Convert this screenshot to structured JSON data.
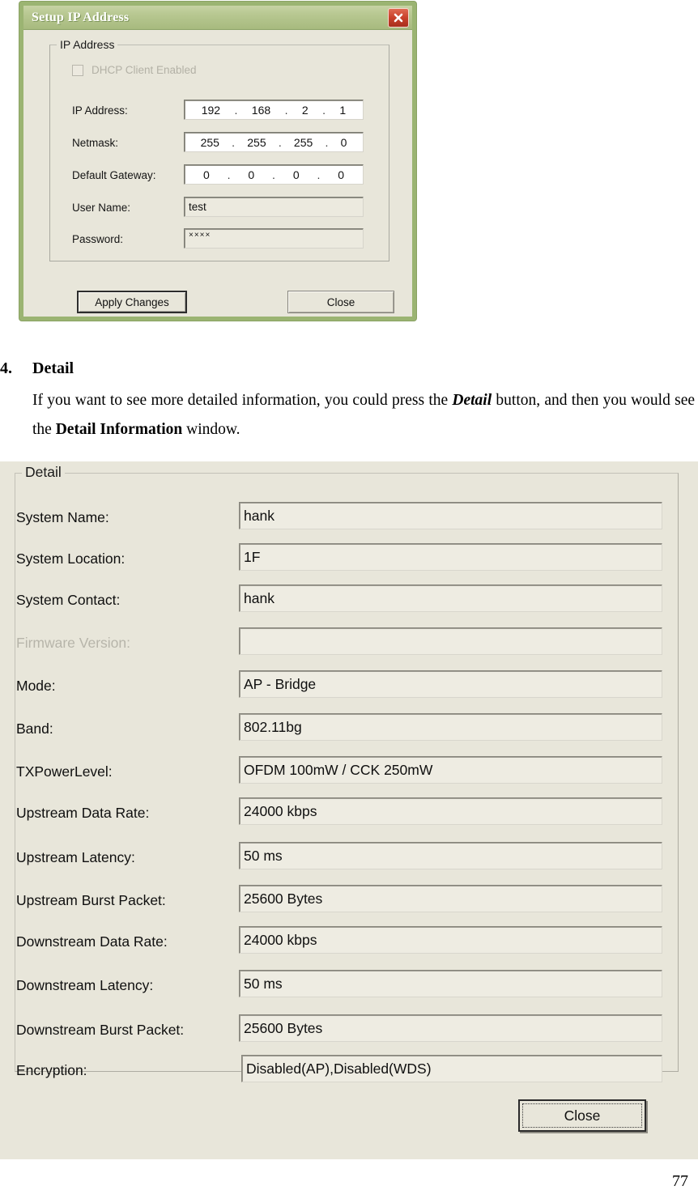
{
  "ip_dialog": {
    "title": "Setup IP Address",
    "close_icon": "close-x-icon",
    "groupbox_legend": "IP Address",
    "dhcp_checkbox_label": "DHCP Client Enabled",
    "dhcp_checked": false,
    "dhcp_enabled": false,
    "fields": [
      {
        "label": "IP Address:",
        "type": "octets",
        "octets": [
          "192",
          "168",
          "2",
          "1"
        ]
      },
      {
        "label": "Netmask:",
        "type": "octets",
        "octets": [
          "255",
          "255",
          "255",
          "0"
        ]
      },
      {
        "label": "Default Gateway:",
        "type": "octets",
        "octets": [
          "0",
          "0",
          "0",
          "0"
        ]
      },
      {
        "label": "User Name:",
        "type": "text",
        "value": "test"
      },
      {
        "label": "Password:",
        "type": "password",
        "value": "××××"
      }
    ],
    "apply_button": "Apply Changes",
    "apply_mnemonic": "A",
    "close_button": "Close",
    "close_mnemonic": "C"
  },
  "body_text": {
    "number": "4.",
    "heading": "Detail",
    "paragraph_1a": "If you want to see more detailed information, you could press the ",
    "paragraph_1b": "Detail",
    "paragraph_1c": " button,",
    "paragraph_2a": "and then you would see the ",
    "paragraph_2b": "Detail Information",
    "paragraph_2c": " window."
  },
  "detail_dialog": {
    "groupbox_legend": "Detail",
    "rows": [
      {
        "label": "System Name:",
        "value": "hank",
        "dim": false
      },
      {
        "label": "System Location:",
        "value": "1F",
        "dim": false
      },
      {
        "label": "System Contact:",
        "value": "hank",
        "dim": false
      },
      {
        "label": "Firmware Version:",
        "value": "",
        "dim": true
      },
      {
        "label": "Mode:",
        "value": "AP - Bridge",
        "dim": false
      },
      {
        "label": "Band:",
        "value": "802.11bg",
        "dim": false
      },
      {
        "label": "TXPowerLevel:",
        "value": "OFDM 100mW / CCK 250mW",
        "dim": false
      },
      {
        "label": "Upstream Data Rate:",
        "value": "24000 kbps",
        "dim": false
      },
      {
        "label": "Upstream Latency:",
        "value": "50 ms",
        "dim": false
      },
      {
        "label": "Upstream Burst Packet:",
        "value": "25600 Bytes",
        "dim": false
      },
      {
        "label": "Downstream Data Rate:",
        "value": "24000 kbps",
        "dim": false
      },
      {
        "label": "Downstream Latency:",
        "value": "50 ms",
        "dim": false
      },
      {
        "label": "Downstream Burst Packet:",
        "value": "25600 Bytes",
        "dim": false
      },
      {
        "label": "Encryption:",
        "value": "Disabled(AP),Disabled(WDS)",
        "dim": false
      }
    ],
    "close_button": "Close",
    "close_mnemonic": "C"
  },
  "page_number": "77",
  "colors": {
    "dialog_face": "#e8e6da",
    "title_green": "#b8c892",
    "border_green": "#9bb472",
    "close_red": "#c8412a",
    "field_white": "#ffffff",
    "disabled_text": "#b3b1a6"
  }
}
